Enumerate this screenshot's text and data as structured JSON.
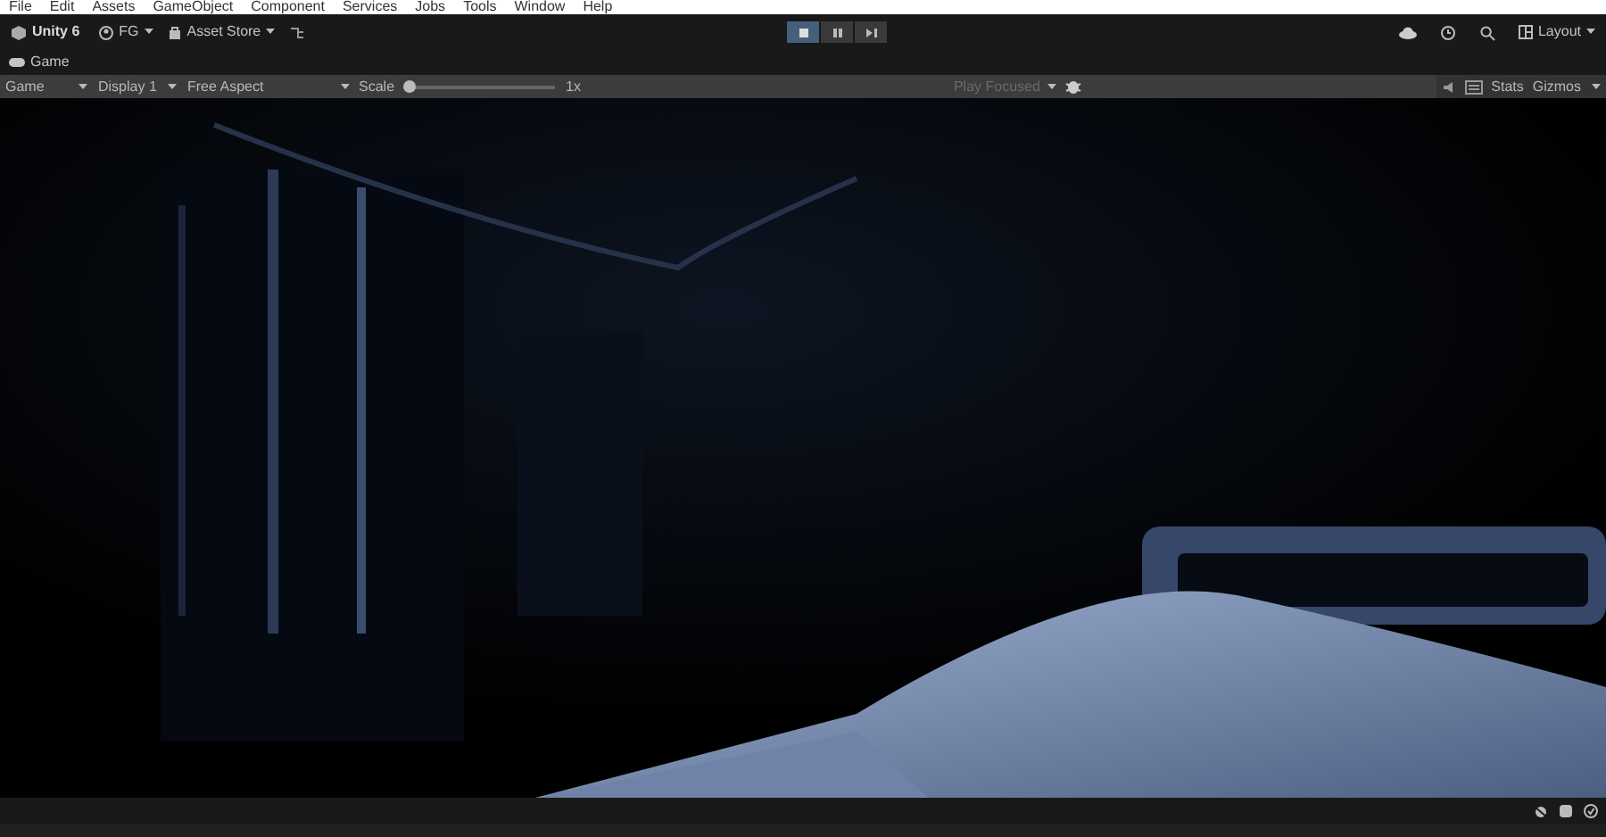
{
  "menu_bar": {
    "items": [
      "File",
      "Edit",
      "Assets",
      "GameObject",
      "Component",
      "Services",
      "Jobs",
      "Tools",
      "Window",
      "Help"
    ]
  },
  "toolbar": {
    "product": "Unity 6",
    "account": "FG",
    "store": "Asset Store",
    "play_controls": [
      {
        "kind": "play",
        "selected": true
      },
      {
        "kind": "pause",
        "selected": false
      },
      {
        "kind": "step",
        "selected": false
      }
    ],
    "layout": "Layout"
  },
  "tab": {
    "label": "Game"
  },
  "game_toolbar": {
    "mode": "Game",
    "display": "Display 1",
    "aspect": "Free Aspect",
    "scale_label": "Scale",
    "scale": {
      "level": 0
    },
    "scale_reading": "1x",
    "play_focused": "Play Focused",
    "play_focused_disabled": true,
    "stats": "Stats",
    "gizmos": "Gizmos"
  }
}
